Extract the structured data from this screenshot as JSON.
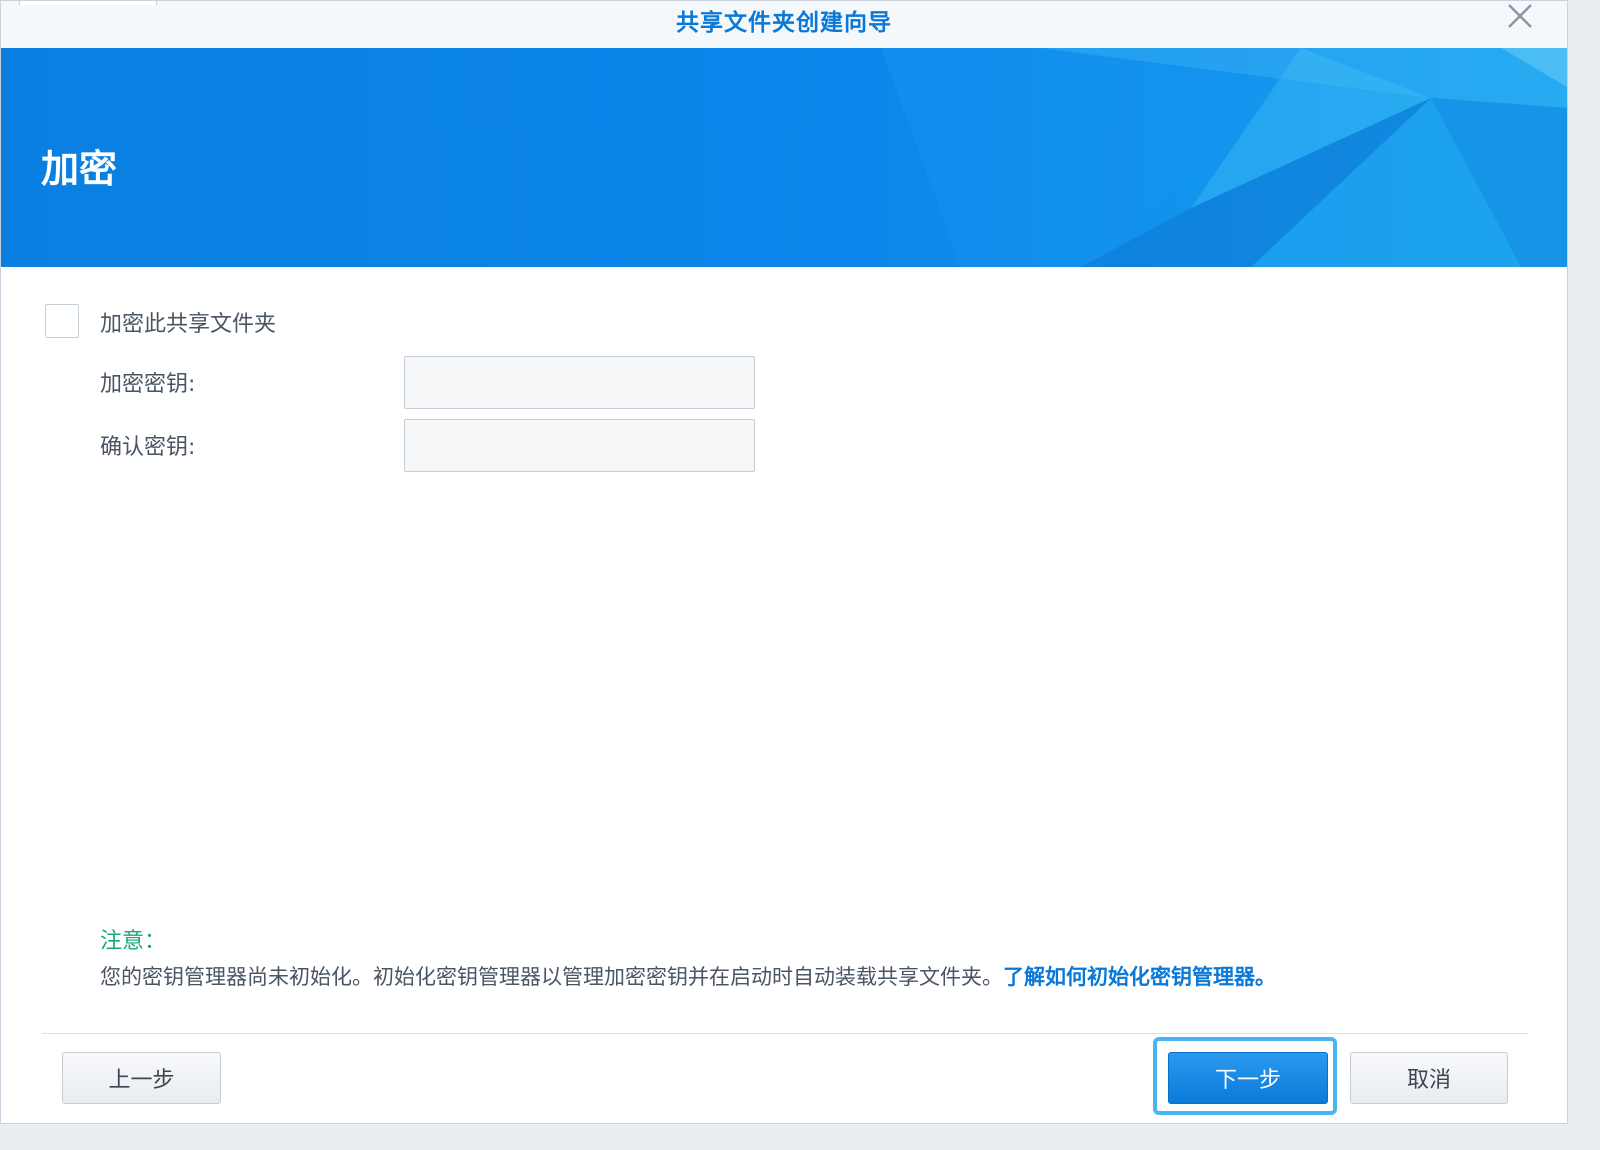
{
  "window": {
    "title": "共享文件夹创建向导",
    "close_icon": "close-icon"
  },
  "banner": {
    "title": "加密",
    "color": "#0a82e6"
  },
  "form": {
    "encrypt_checkbox_label": "加密此共享文件夹",
    "encrypt_checked": false,
    "key_label": "加密密钥:",
    "key_value": "",
    "confirm_label": "确认密钥:",
    "confirm_value": ""
  },
  "note": {
    "title": "注意：",
    "text": "您的密钥管理器尚未初始化。初始化密钥管理器以管理加密密钥并在启动时自动装载共享文件夹。",
    "link": "了解如何初始化密钥管理器。"
  },
  "buttons": {
    "prev": "上一步",
    "next": "下一步",
    "cancel": "取消"
  },
  "colors": {
    "accent": "#0a78d8",
    "note_green": "#19a974",
    "focus_ring": "#49b6f2"
  }
}
